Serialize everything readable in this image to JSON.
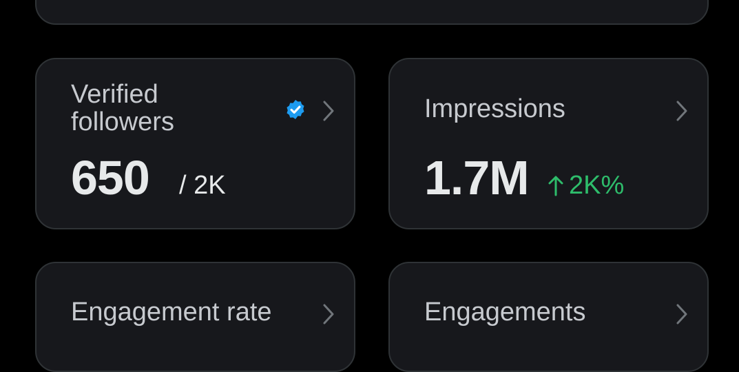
{
  "cards": [
    {
      "label": "Verified followers",
      "label_line1": "Verified",
      "label_line2": "followers",
      "value": "650",
      "total": "/ 2K",
      "icon": "verified-badge-icon",
      "accent": "#1d9bf0"
    },
    {
      "label": "Impressions",
      "value": "1.7M",
      "change_arrow_icon": "arrow-up-icon",
      "change": "2K%",
      "change_color": "#2ebd6b"
    },
    {
      "label": "Engagement rate"
    },
    {
      "label": "Engagements"
    }
  ],
  "icons": {
    "chevron": "chevron-right-icon"
  },
  "colors": {
    "background": "#000000",
    "card": "#17181c",
    "border": "#2f3336",
    "text": "#e7e9ea",
    "muted": "#c7cacf"
  }
}
